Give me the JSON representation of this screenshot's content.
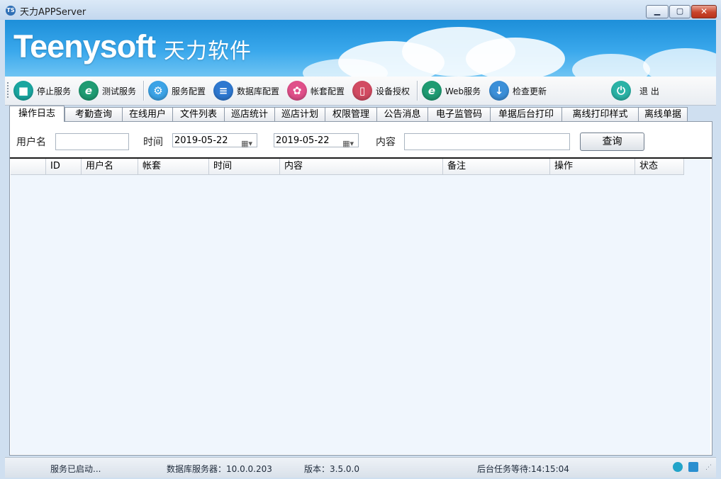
{
  "window": {
    "title": "天力APPServer",
    "app_icon_text": "TS",
    "controls": {
      "minimize": "▁",
      "maximize": "▢",
      "close": "✕"
    }
  },
  "banner": {
    "logo_en": "Teenysoft",
    "logo_cn": "天力软件"
  },
  "toolbar": {
    "items": [
      {
        "label": "停止服务",
        "icon": "stop-icon",
        "glyph": "■",
        "color": "#1aa6a0"
      },
      {
        "label": "测试服务",
        "icon": "ie-icon",
        "glyph": "e",
        "color": "#1f9b72"
      },
      {
        "label": "服务配置",
        "icon": "service-config-icon",
        "glyph": "⚙",
        "color": "#3ca3e6"
      },
      {
        "label": "数据库配置",
        "icon": "database-icon",
        "glyph": "≡",
        "color": "#2e78d0"
      },
      {
        "label": "帐套配置",
        "icon": "account-config-icon",
        "glyph": "✿",
        "color": "#e0508a"
      },
      {
        "label": "设备授权",
        "icon": "device-icon",
        "glyph": "▯",
        "color": "#d24b62"
      },
      {
        "label": "Web服务",
        "icon": "web-icon",
        "glyph": "e",
        "color": "#1f9b72"
      },
      {
        "label": "检查更新",
        "icon": "download-icon",
        "glyph": "↓",
        "color": "#3b8fd8"
      },
      {
        "label": "退 出",
        "icon": "power-icon",
        "glyph": "⏻",
        "color": "#2bb3a6"
      }
    ]
  },
  "tabs": [
    "操作日志",
    "考勤查询",
    "在线用户",
    "文件列表",
    "巡店统计",
    "巡店计划",
    "权限管理",
    "公告消息",
    "电子监管码",
    "单据后台打印",
    "离线打印样式",
    "离线单据"
  ],
  "search": {
    "username_label": "用户名",
    "username_value": "",
    "time_label": "时间",
    "date_from": "2019-05-22",
    "date_to": "2019-05-22",
    "content_label": "内容",
    "content_value": "",
    "query_button": "查询"
  },
  "grid": {
    "columns": [
      "",
      "ID",
      "用户名",
      "帐套",
      "时间",
      "内容",
      "备注",
      "操作",
      "状态"
    ],
    "rows": []
  },
  "statusbar": {
    "service": "服务已启动...",
    "db_server": "数据库服务器：10.0.0.203",
    "version": "版本：3.5.0.0",
    "background_task": "后台任务等待:14:15:04"
  }
}
